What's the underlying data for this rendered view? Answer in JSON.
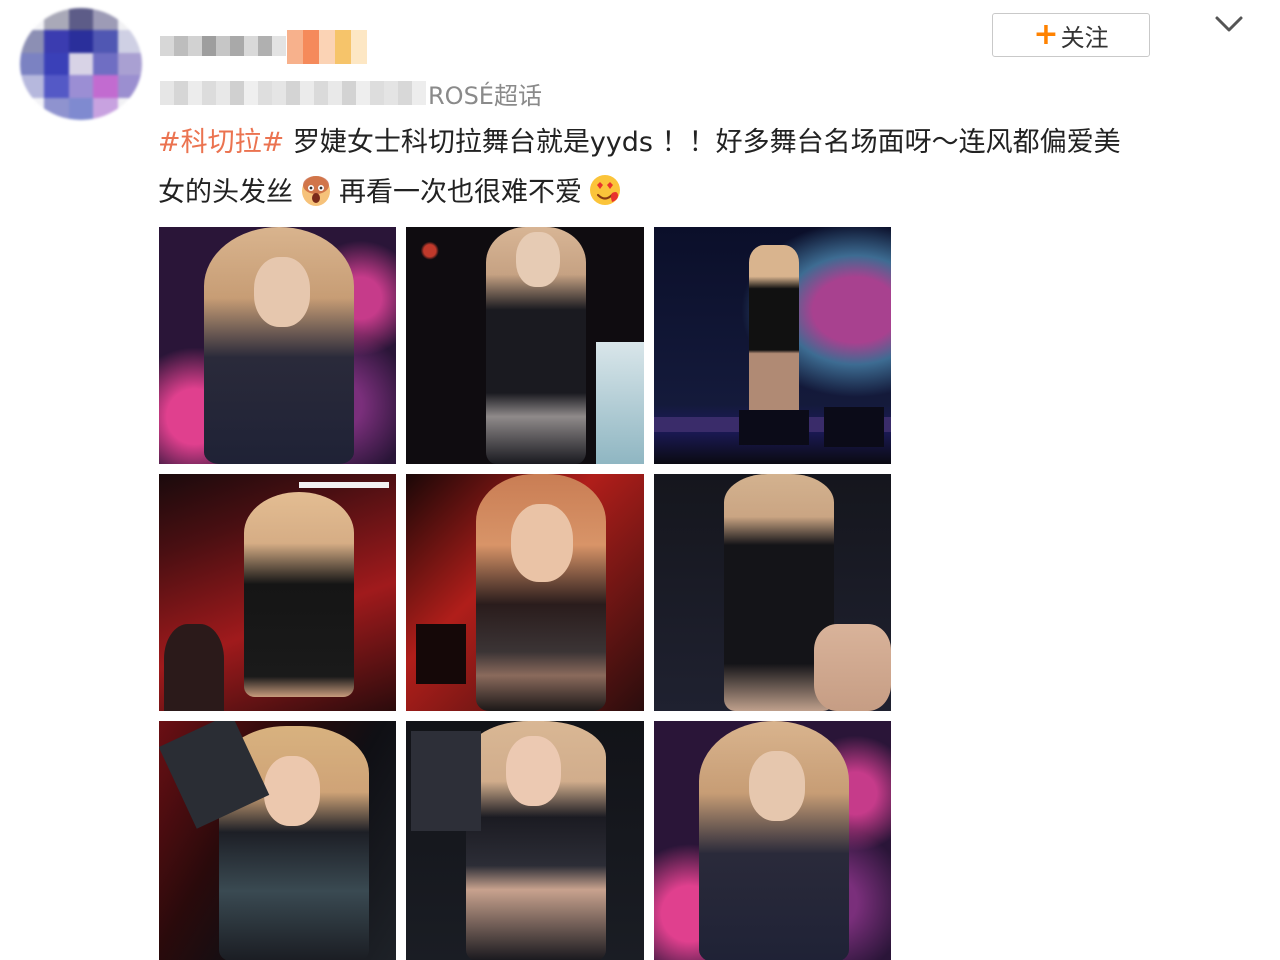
{
  "user": {
    "topic_suffix": "ROSÉ超话"
  },
  "follow": {
    "plus": "+",
    "label": "关注"
  },
  "post": {
    "hashtag": "#科切拉#",
    "line1_rest": " 罗婕女士科切拉舞台就是yyds ！！好多舞台名场面呀～连风都偏爱美",
    "line2_a": "女的头发丝",
    "line2_b": "再看一次也很难不爱",
    "emoji_1": "scream-emoji",
    "emoji_2": "heart-face-emoji"
  },
  "images": [
    {
      "name": "photo-1",
      "scene": "pink-bokeh-hair"
    },
    {
      "name": "photo-2",
      "scene": "dark-stage-dress"
    },
    {
      "name": "photo-3",
      "scene": "stage-mic-psychedelic"
    },
    {
      "name": "photo-4",
      "scene": "red-stage-dancing"
    },
    {
      "name": "photo-5",
      "scene": "red-closeup-glitter"
    },
    {
      "name": "photo-6",
      "scene": "dark-dance-pose"
    },
    {
      "name": "photo-7",
      "scene": "red-hair-arm"
    },
    {
      "name": "photo-8",
      "scene": "dark-mic-glitter"
    },
    {
      "name": "photo-9",
      "scene": "pink-bokeh-hair"
    }
  ],
  "colors": {
    "hashtag": "#eb7350",
    "follow_plus": "#ff8200",
    "topic_text": "#8a8a8a"
  }
}
